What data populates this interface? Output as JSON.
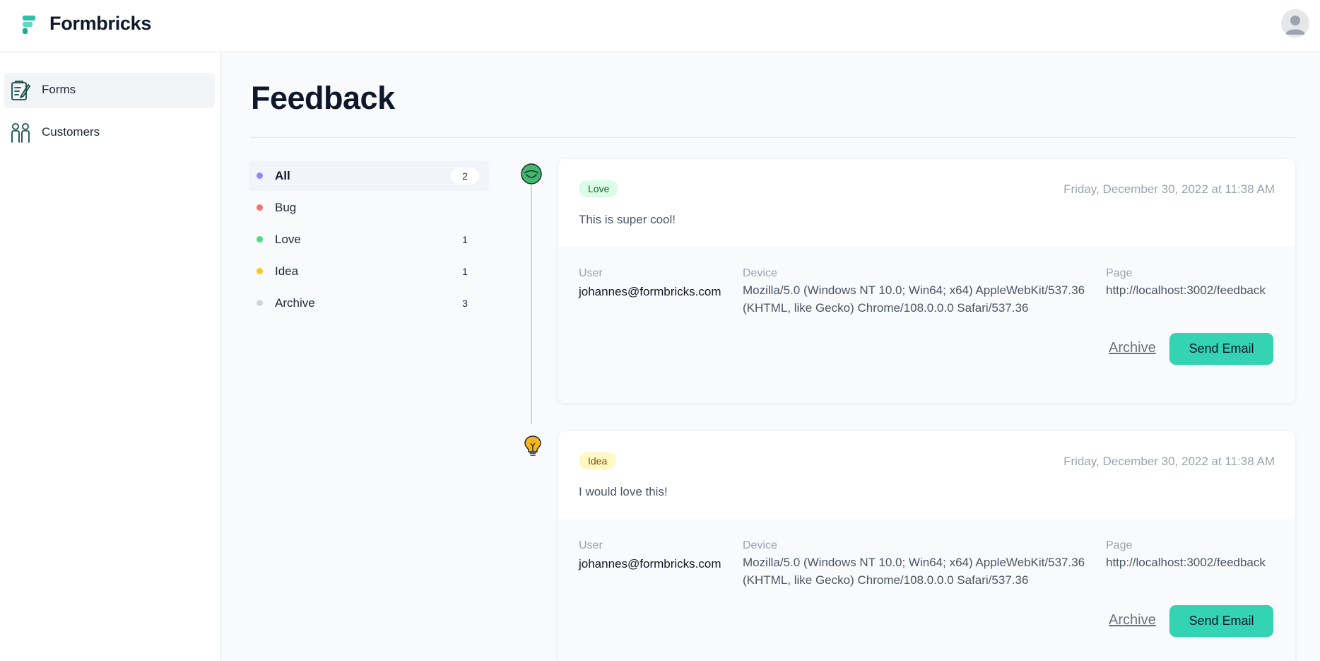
{
  "app": {
    "name": "Formbricks"
  },
  "colors": {
    "accent": "#34d3b4",
    "brand_teal": "#2cc1a6"
  },
  "sidebar": {
    "items": [
      {
        "label": "Forms",
        "icon": "clipboard-edit-icon",
        "active": true
      },
      {
        "label": "Customers",
        "icon": "users-icon",
        "active": false
      }
    ]
  },
  "page": {
    "title": "Feedback"
  },
  "filters": [
    {
      "label": "All",
      "count": "2",
      "color": "#8b8cf8",
      "active": true
    },
    {
      "label": "Bug",
      "count": "",
      "color": "#f87171",
      "active": false
    },
    {
      "label": "Love",
      "count": "1",
      "color": "#4ade80",
      "active": false
    },
    {
      "label": "Idea",
      "count": "1",
      "color": "#facc15",
      "active": false
    },
    {
      "label": "Archive",
      "count": "3",
      "color": "#d1d5db",
      "active": false
    }
  ],
  "feedback": [
    {
      "type": "Love",
      "type_icon": "smiley-face-icon",
      "badge_bg": "#dcfce7",
      "badge_fg": "#166534",
      "timestamp": "Friday, December 30, 2022 at 11:38 AM",
      "message": "This is super cool!",
      "user_label": "User",
      "user": "johannes@formbricks.com",
      "device_label": "Device",
      "device_line1": "Mozilla/5.0 (Windows NT 10.0; Win64; x64) AppleWebKit/537.36",
      "device_line2": "(KHTML, like Gecko) Chrome/108.0.0.0 Safari/537.36",
      "page_label": "Page",
      "page": "http://localhost:3002/feedback",
      "archive_label": "Archive",
      "send_label": "Send Email"
    },
    {
      "type": "Idea",
      "type_icon": "lightbulb-icon",
      "badge_bg": "#fef9c3",
      "badge_fg": "#854d0e",
      "timestamp": "Friday, December 30, 2022 at 11:38 AM",
      "message": "I would love this!",
      "user_label": "User",
      "user": "johannes@formbricks.com",
      "device_label": "Device",
      "device_line1": "Mozilla/5.0 (Windows NT 10.0; Win64; x64) AppleWebKit/537.36",
      "device_line2": "(KHTML, like Gecko) Chrome/108.0.0.0 Safari/537.36",
      "page_label": "Page",
      "page": "http://localhost:3002/feedback",
      "archive_label": "Archive",
      "send_label": "Send Email"
    }
  ]
}
